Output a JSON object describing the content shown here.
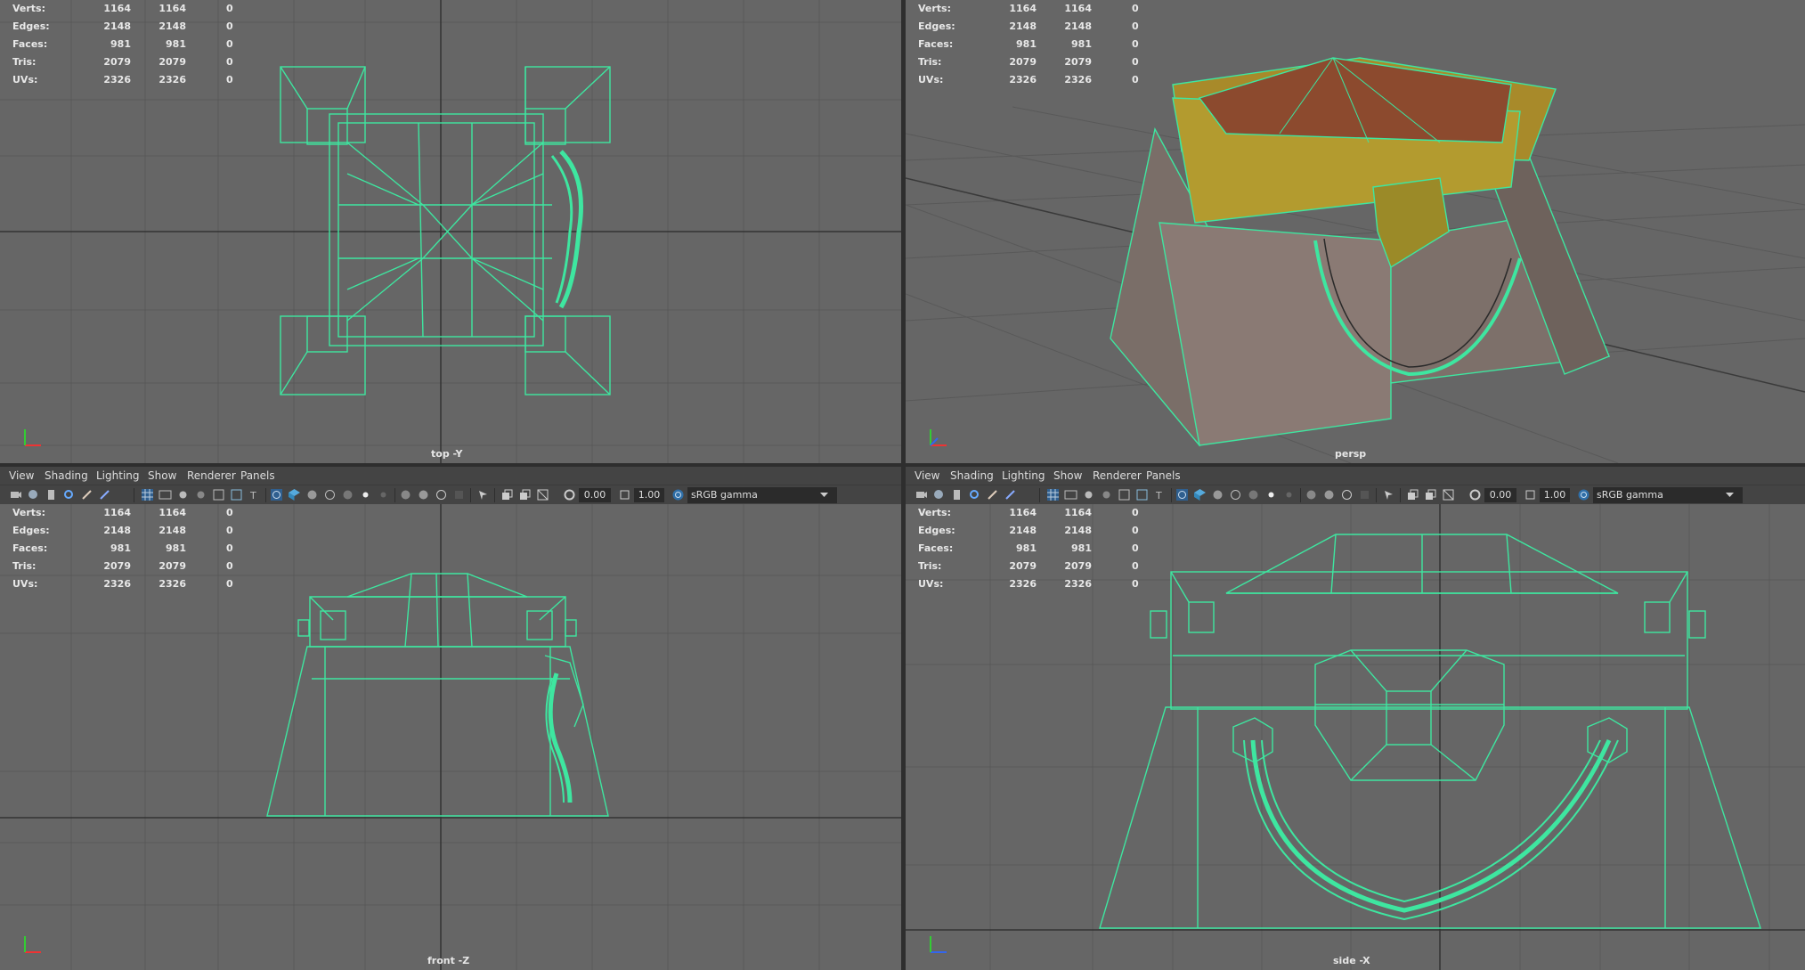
{
  "stats": {
    "rows": [
      {
        "label": "Verts:",
        "a": "1164",
        "b": "1164",
        "c": "0"
      },
      {
        "label": "Edges:",
        "a": "2148",
        "b": "2148",
        "c": "0"
      },
      {
        "label": "Faces:",
        "a": "981",
        "b": "981",
        "c": "0"
      },
      {
        "label": "Tris:",
        "a": "2079",
        "b": "2079",
        "c": "0"
      },
      {
        "label": "UVs:",
        "a": "2326",
        "b": "2326",
        "c": "0"
      }
    ]
  },
  "viewports": {
    "top": {
      "camera": "top -Y"
    },
    "persp": {
      "camera": "persp"
    },
    "front": {
      "camera": "front -Z"
    },
    "side": {
      "camera": "side -X"
    }
  },
  "menu": {
    "view": "View",
    "shading": "Shading",
    "lighting": "Lighting",
    "show": "Show",
    "renderer": "Renderer",
    "panels": "Panels"
  },
  "toolbar": {
    "exposure": "0.00",
    "gamma": "1.00",
    "color_space": "sRGB gamma"
  },
  "colors": {
    "wire": "#3ee6a0",
    "viewport_bg": "#666666",
    "grid": "#5a5a5a",
    "grid_axis": "#333333"
  },
  "icons": [
    "camera-icon",
    "grid-icon",
    "wireframe-icon",
    "smooth-shade-icon",
    "texture-icon",
    "light-icon",
    "shadow-icon",
    "isolate-icon",
    "xray-icon",
    "exposure-icon",
    "gamma-icon",
    "color-space-icon",
    "dropdown-arrow-icon"
  ]
}
